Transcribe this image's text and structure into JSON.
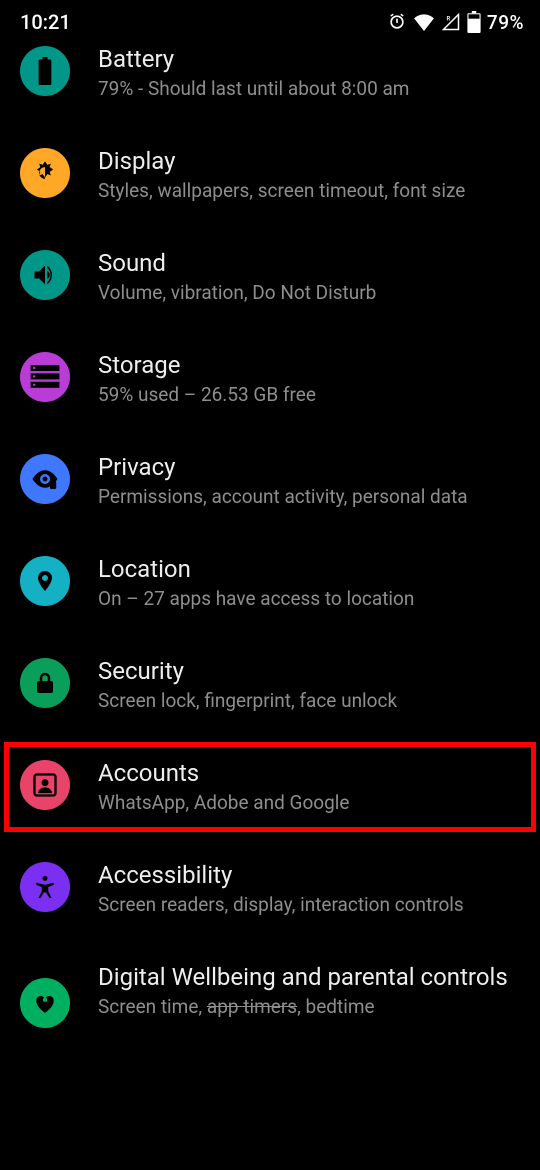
{
  "status": {
    "time": "10:21",
    "battery": "79%"
  },
  "items": [
    {
      "title": "Battery",
      "subtitle": "79% - Should last until about 8:00 am"
    },
    {
      "title": "Display",
      "subtitle": "Styles, wallpapers, screen timeout, font size"
    },
    {
      "title": "Sound",
      "subtitle": "Volume, vibration, Do Not Disturb"
    },
    {
      "title": "Storage",
      "subtitle": "59% used – 26.53 GB free"
    },
    {
      "title": "Privacy",
      "subtitle": "Permissions, account activity, personal data"
    },
    {
      "title": "Location",
      "subtitle": "On – 27 apps have access to location"
    },
    {
      "title": "Security",
      "subtitle": "Screen lock, fingerprint, face unlock"
    },
    {
      "title": "Accounts",
      "subtitle": "WhatsApp, Adobe and Google"
    },
    {
      "title": "Accessibility",
      "subtitle": "Screen readers, display, interaction controls"
    },
    {
      "title": "Digital Wellbeing and parental controls",
      "sub_pre": "Screen time, ",
      "sub_strike": "app timers",
      "sub_post": ", bedtime"
    }
  ]
}
